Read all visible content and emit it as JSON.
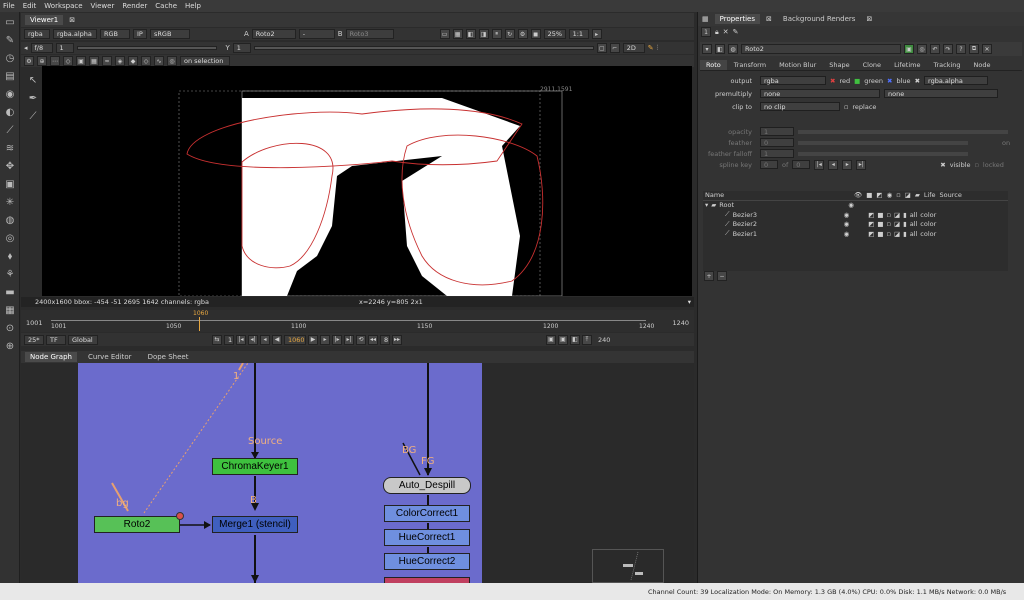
{
  "menu": [
    "File",
    "Edit",
    "Workspace",
    "Viewer",
    "Render",
    "Cache",
    "Help"
  ],
  "viewer": {
    "tab_label": "Viewer1",
    "channels": "rgba",
    "layer": "rgba.alpha",
    "color": "RGB",
    "ip": "IP",
    "lut": "sRGB",
    "input_a": "Roto2",
    "a_op": "-",
    "input_b": "Roto3",
    "zoom": "25%",
    "ratio": "1:1",
    "fstop": "f/8",
    "gain": "1",
    "y_label": "Y",
    "gamma": "1",
    "mode2d": "2D",
    "on_selection": "on selection",
    "bbox_label": "2911,1591",
    "status_left": "2400x1600  bbox: -454 -51 2695 1642 channels: rgba",
    "status_right": "x=2246 y=805 2x1"
  },
  "timeline": {
    "start": "1001",
    "end": "1240",
    "ticks": [
      "1001",
      "1050",
      "1100",
      "1150",
      "1200",
      "1240"
    ],
    "current": "1060",
    "fps": "25*",
    "tf": "TF",
    "global": "Global",
    "frame_field": "1060",
    "step": "1",
    "incr": "8",
    "last": "240"
  },
  "node_tabs": [
    "Node Graph",
    "Curve Editor",
    "Dope Sheet"
  ],
  "nodes": {
    "chroma": "ChromaKeyer1",
    "roto": "Roto2",
    "merge": "Merge1 (stencil)",
    "despill": "Auto_Despill",
    "cc1": "ColorCorrect1",
    "hc1": "HueCorrect1",
    "hc2": "HueCorrect2",
    "label_source": "Source",
    "label_b": "B",
    "label_bg": "bg",
    "label_1": "1",
    "label_BG": "BG",
    "label_FG": "FG"
  },
  "props": {
    "tabs": [
      "Properties",
      "Background Renders"
    ],
    "node_name": "Roto2",
    "subtabs": [
      "Roto",
      "Transform",
      "Motion Blur",
      "Shape",
      "Clone",
      "Lifetime",
      "Tracking",
      "Node"
    ],
    "output_label": "output",
    "output_value": "rgba",
    "red": "red",
    "green": "green",
    "blue": "blue",
    "alpha_value": "rgba.alpha",
    "premultiply_label": "premultiply",
    "premultiply_value": "none",
    "premultiply_value2": "none",
    "clipto_label": "clip to",
    "clipto_value": "no clip",
    "replace": "replace",
    "opacity_label": "opacity",
    "opacity_value": "1",
    "feather_label": "feather",
    "feather_value": "0",
    "falloff_label": "feather falloff",
    "falloff_value": "1",
    "splinekey_label": "spline key",
    "splinekey_value": "0",
    "of_label": "of",
    "of_value": "0",
    "visible": "visible",
    "locked": "locked",
    "on": "on",
    "table_headers": [
      "Name",
      "Life",
      "Source"
    ],
    "layers": [
      {
        "name": "Root",
        "life": "",
        "source": ""
      },
      {
        "name": "Bezier3",
        "life": "all",
        "source": "color"
      },
      {
        "name": "Bezier2",
        "life": "all",
        "source": "color"
      },
      {
        "name": "Bezier1",
        "life": "all",
        "source": "color"
      }
    ]
  },
  "statusbar": "Channel Count: 39  Localization Mode: On  Memory: 1.3 GB (4.0%)  CPU: 0.0%  Disk: 1.1 MB/s  Network: 0.0 MB/s"
}
